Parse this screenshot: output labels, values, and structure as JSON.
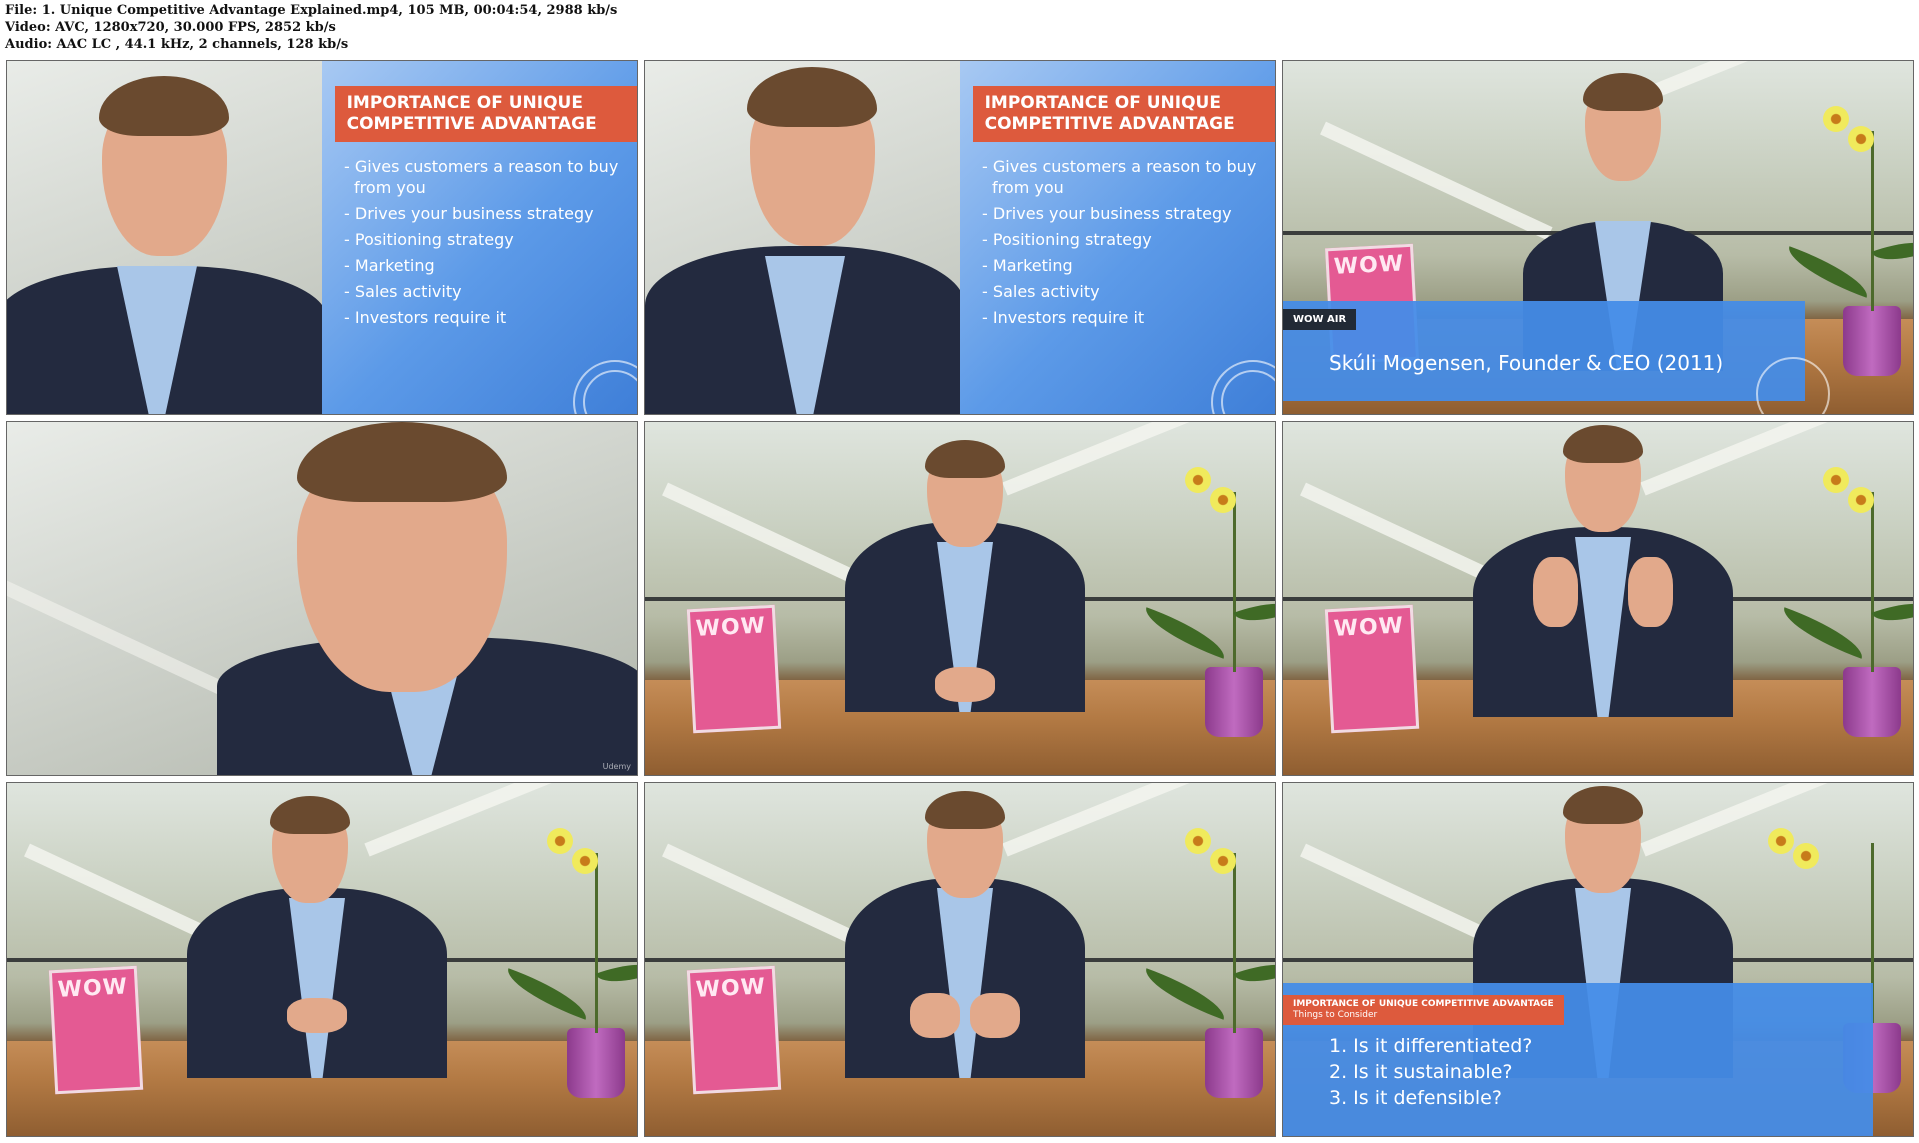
{
  "header": {
    "file_line": "File: 1. Unique Competitive Advantage Explained.mp4, 105 MB, 00:04:54, 2988 kb/s",
    "video_line": "Video: AVC, 1280x720, 30.000 FPS, 2852 kb/s",
    "audio_line": "Audio: AAC LC , 44.1 kHz, 2 channels, 128 kb/s"
  },
  "slide": {
    "title": "IMPORTANCE OF UNIQUE COMPETITIVE ADVANTAGE",
    "bullets": [
      "- Gives customers a reason to buy from you",
      "- Drives your business strategy",
      "- Positioning strategy",
      "- Marketing",
      "- Sales activity",
      "- Investors require it"
    ]
  },
  "lower_third": {
    "tag": "WOW AIR",
    "name": "Skúli Mogensen, Founder & CEO (2011)"
  },
  "questions": {
    "tag_title": "IMPORTANCE OF UNIQUE COMPETITIVE ADVANTAGE",
    "tag_subtitle": "Things to Consider",
    "items": [
      "1. Is it differentiated?",
      "2. Is it sustainable?",
      "3. Is it defensible?"
    ]
  },
  "magazine_title": "WOW",
  "watermark": "Udemy"
}
